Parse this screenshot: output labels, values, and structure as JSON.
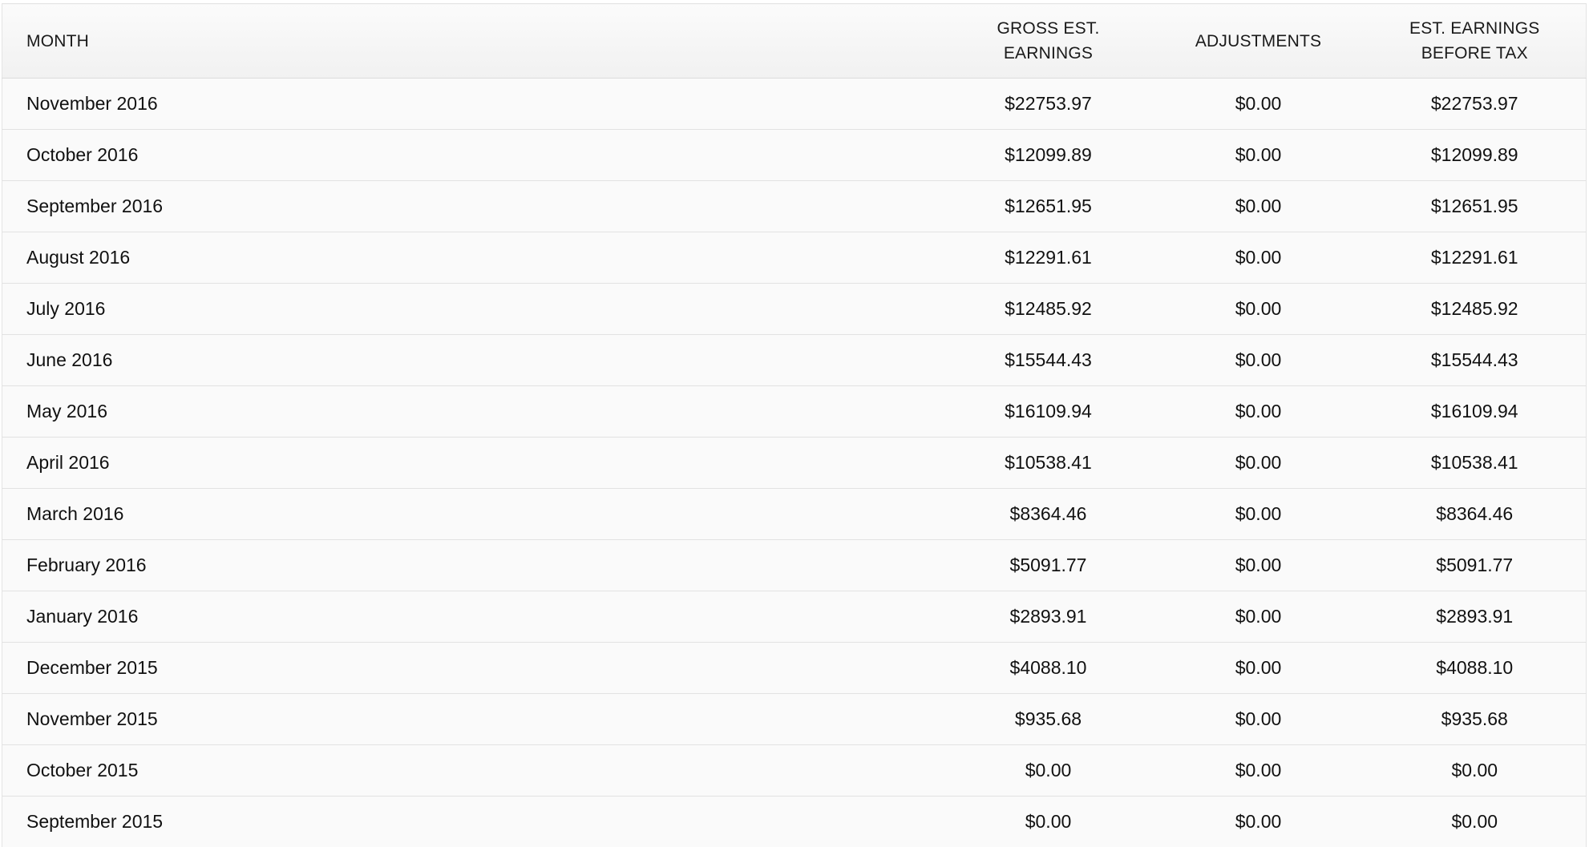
{
  "table": {
    "headers": {
      "month": "MONTH",
      "gross_line1": "GROSS EST.",
      "gross_line2": "EARNINGS",
      "adjustments": "ADJUSTMENTS",
      "net_line1": "EST. EARNINGS",
      "net_line2": "BEFORE TAX"
    },
    "rows": [
      {
        "month": "November 2016",
        "gross": "$22753.97",
        "adjustments": "$0.00",
        "net": "$22753.97"
      },
      {
        "month": "October 2016",
        "gross": "$12099.89",
        "adjustments": "$0.00",
        "net": "$12099.89"
      },
      {
        "month": "September 2016",
        "gross": "$12651.95",
        "adjustments": "$0.00",
        "net": "$12651.95"
      },
      {
        "month": "August 2016",
        "gross": "$12291.61",
        "adjustments": "$0.00",
        "net": "$12291.61"
      },
      {
        "month": "July 2016",
        "gross": "$12485.92",
        "adjustments": "$0.00",
        "net": "$12485.92"
      },
      {
        "month": "June 2016",
        "gross": "$15544.43",
        "adjustments": "$0.00",
        "net": "$15544.43"
      },
      {
        "month": "May 2016",
        "gross": "$16109.94",
        "adjustments": "$0.00",
        "net": "$16109.94"
      },
      {
        "month": "April 2016",
        "gross": "$10538.41",
        "adjustments": "$0.00",
        "net": "$10538.41"
      },
      {
        "month": "March 2016",
        "gross": "$8364.46",
        "adjustments": "$0.00",
        "net": "$8364.46"
      },
      {
        "month": "February 2016",
        "gross": "$5091.77",
        "adjustments": "$0.00",
        "net": "$5091.77"
      },
      {
        "month": "January 2016",
        "gross": "$2893.91",
        "adjustments": "$0.00",
        "net": "$2893.91"
      },
      {
        "month": "December 2015",
        "gross": "$4088.10",
        "adjustments": "$0.00",
        "net": "$4088.10"
      },
      {
        "month": "November 2015",
        "gross": "$935.68",
        "adjustments": "$0.00",
        "net": "$935.68"
      },
      {
        "month": "October 2015",
        "gross": "$0.00",
        "adjustments": "$0.00",
        "net": "$0.00"
      },
      {
        "month": "September 2015",
        "gross": "$0.00",
        "adjustments": "$0.00",
        "net": "$0.00"
      }
    ]
  }
}
